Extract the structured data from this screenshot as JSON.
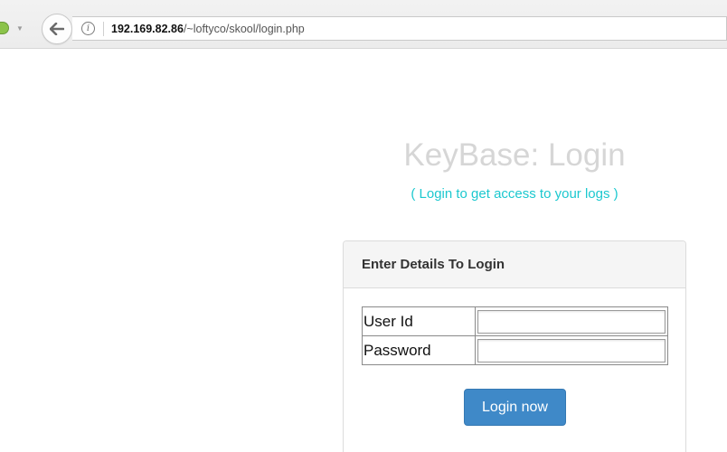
{
  "browser": {
    "url_host": "192.169.82.86",
    "url_path": "/~loftyco/skool/login.php",
    "icons": {
      "extension": "extension-icon",
      "dropdown": "chevron-down-icon",
      "back": "back-arrow-icon",
      "info": "info-icon"
    }
  },
  "page": {
    "title": "KeyBase: Login",
    "subtitle": "( Login to get access to your logs )"
  },
  "login_panel": {
    "heading": "Enter Details To Login",
    "fields": [
      {
        "label": "User Id",
        "value": "",
        "type": "text"
      },
      {
        "label": "Password",
        "value": "",
        "type": "password"
      }
    ],
    "submit_label": "Login now"
  },
  "colors": {
    "title": "#d6d6d6",
    "subtitle": "#1cc8cf",
    "button": "#3f89c8",
    "panel_heading_bg": "#f5f5f5"
  }
}
